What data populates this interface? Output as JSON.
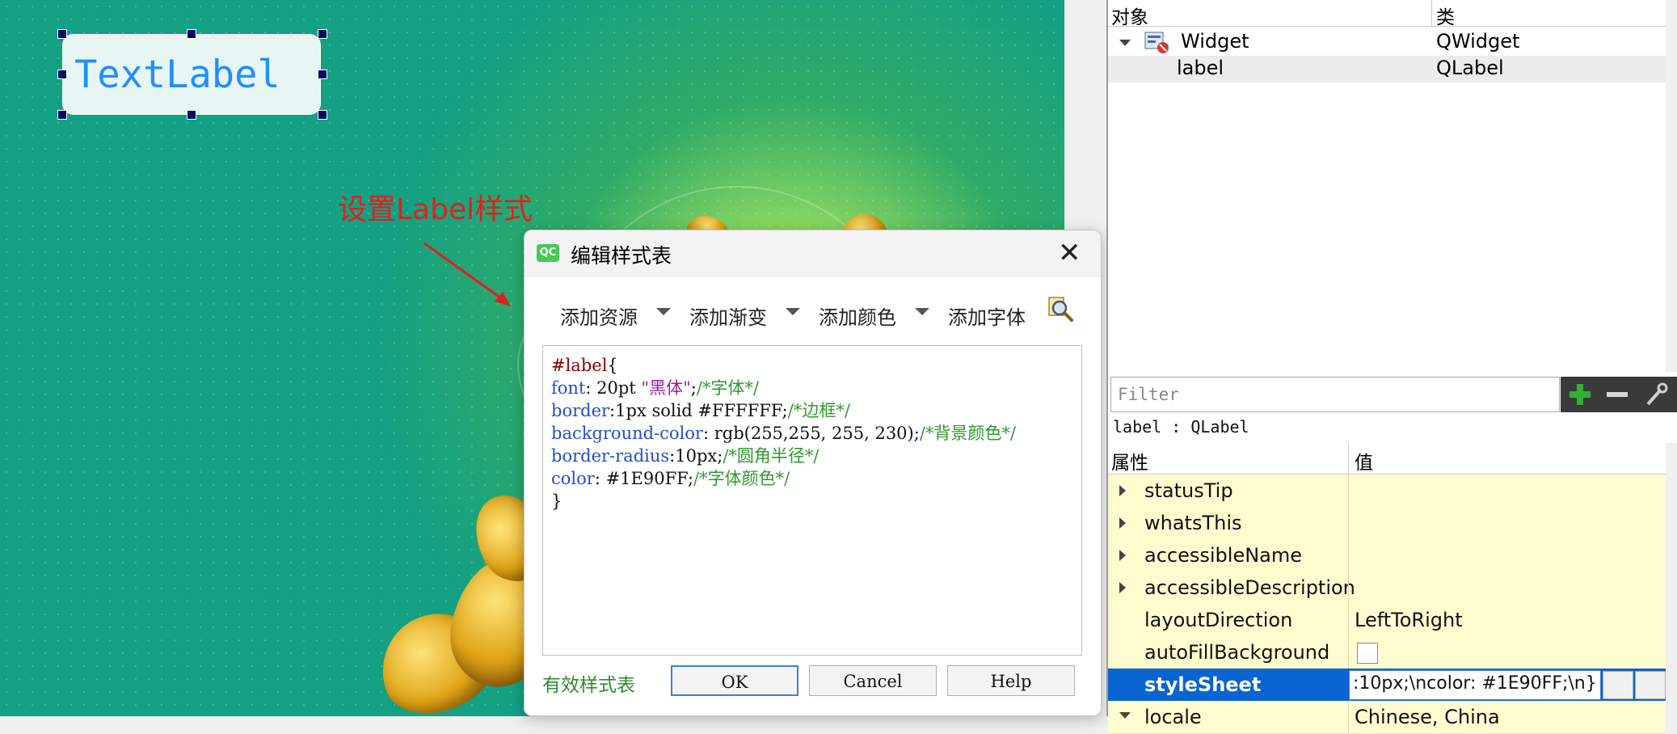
{
  "canvas": {
    "label_text": "TextLabel",
    "annotation": "设置Label样式"
  },
  "dialog": {
    "title": "编辑样式表",
    "qc_badge": "QC",
    "close_glyph": "✕",
    "toolbar": [
      "添加资源",
      "添加渐变",
      "添加颜色",
      "添加字体"
    ],
    "code": {
      "l1_sel": "#label",
      "l1_brace": "{",
      "l2_prop": "font",
      "l2_val": ": 20pt ",
      "l2_str": "\"黑体\"",
      "l2_semi": ";",
      "l2_cmt": "/*字体*/",
      "l3_prop": "border",
      "l3_val": ":1px solid #FFFFFF;",
      "l3_cmt": "/*边框*/",
      "l4_prop": "background-color",
      "l4_val": ": rgb(255,255, 255, 230);",
      "l4_cmt": "/*背景颜色*/",
      "l5_prop": "border-radius",
      "l5_val": ":10px;",
      "l5_cmt": "/*圆角半径*/",
      "l6_prop": "color",
      "l6_val": ": #1E90FF;",
      "l6_cmt": "/*字体颜色*/",
      "l7": "}"
    },
    "status": "有效样式表",
    "buttons": {
      "ok": "OK",
      "cancel": "Cancel",
      "help": "Help"
    }
  },
  "object_inspector": {
    "col_object": "对象",
    "col_class": "类",
    "rows": [
      {
        "name": "Widget",
        "cls": "QWidget"
      },
      {
        "name": "label",
        "cls": "QLabel"
      }
    ]
  },
  "property_editor": {
    "filter_placeholder": "Filter",
    "class_line": "label : QLabel",
    "col_property": "属性",
    "col_value": "值",
    "rows": [
      {
        "name": "statusTip",
        "value": ""
      },
      {
        "name": "whatsThis",
        "value": ""
      },
      {
        "name": "accessibleName",
        "value": ""
      },
      {
        "name": "accessibleDescription",
        "value": ""
      },
      {
        "name": "layoutDirection",
        "value": "LeftToRight"
      },
      {
        "name": "autoFillBackground",
        "value": ""
      },
      {
        "name": "styleSheet",
        "value": ":10px;\\ncolor: #1E90FF;\\n}"
      },
      {
        "name": "locale",
        "value": "Chinese, China"
      }
    ]
  },
  "colors": {
    "accent": "#1E90FF",
    "selection": "#0a64d2",
    "property_bg": "#fffccf"
  }
}
